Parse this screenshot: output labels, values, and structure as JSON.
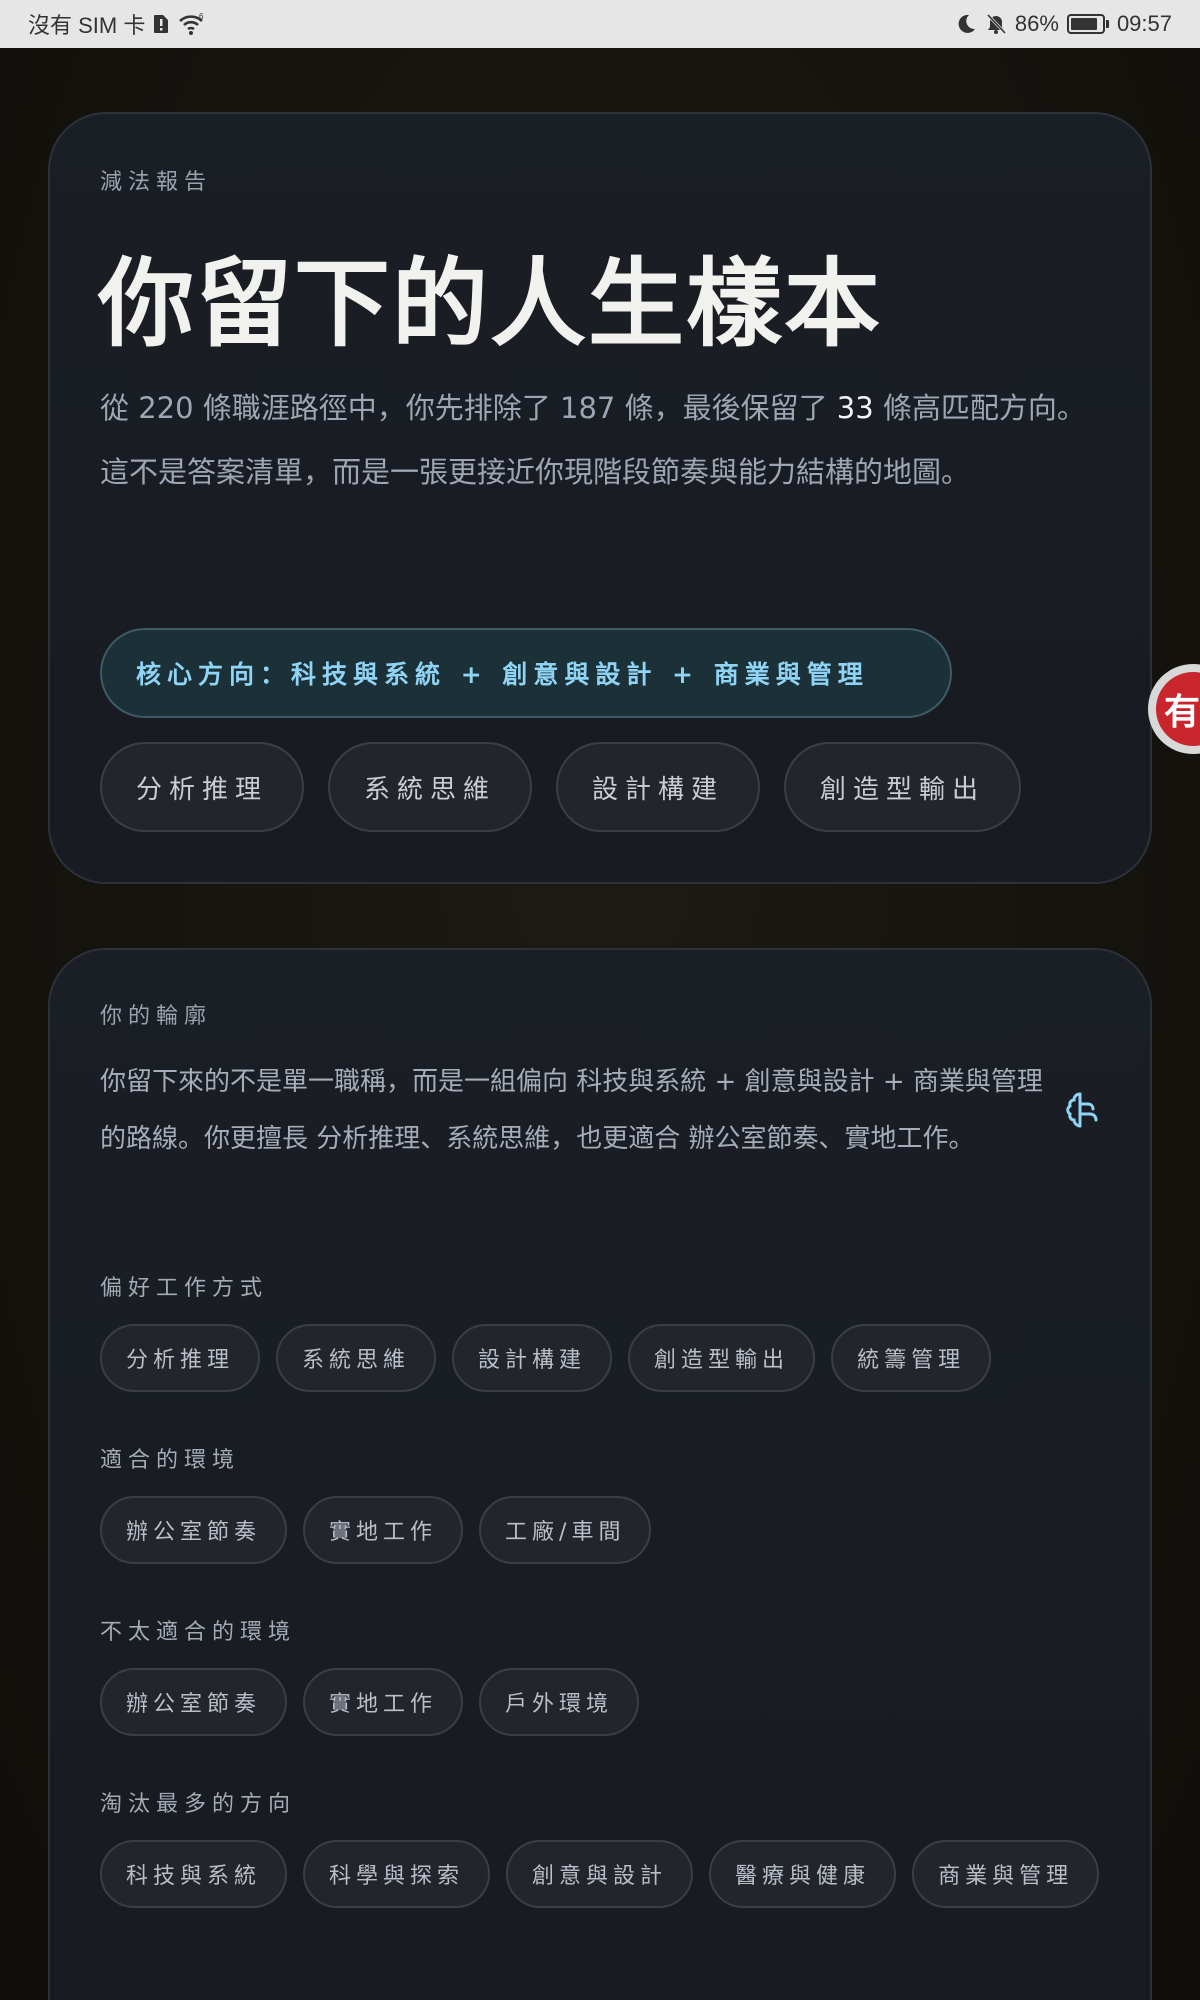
{
  "status_bar": {
    "carrier": "沒有 SIM 卡",
    "battery_percent": "86%",
    "battery_level": 0.86,
    "time": "09:57"
  },
  "report": {
    "eyebrow": "減法報告",
    "title": "你留下的人生樣本",
    "desc_part1": "從 220 條職涯路徑中，你先排除了 187 條，最後保留了 ",
    "desc_highlight": "33",
    "desc_part2": " 條高匹配方向。這不是答案清單，而是一張更接近你現階段節奏與能力結構的地圖。",
    "core_direction": "核心方向：科技與系統 + 創意與設計 + 商業與管理",
    "strengths": [
      "分析推理",
      "系統思維",
      "設計構建",
      "創造型輸出"
    ]
  },
  "profile": {
    "eyebrow": "你的輪廓",
    "text": "你留下來的不是單一職稱，而是一組偏向 科技與系統 + 創意與設計 + 商業與管理 的路線。你更擅長 分析推理、系統思維，也更適合 辦公室節奏、實地工作。",
    "sections": [
      {
        "label": "偏好工作方式",
        "chips": [
          "分析推理",
          "系統思維",
          "設計構建",
          "創造型輸出",
          "統籌管理"
        ]
      },
      {
        "label": "適合的環境",
        "chips": [
          "辦公室節奏",
          "實地工作",
          "工廠/車間"
        ]
      },
      {
        "label": "不太適合的環境",
        "chips": [
          "辦公室節奏",
          "實地工作",
          "戶外環境"
        ]
      },
      {
        "label": "淘汰最多的方向",
        "chips": [
          "科技與系統",
          "科學與探索",
          "創意與設計",
          "醫療與健康",
          "商業與管理"
        ]
      }
    ]
  },
  "side_badge": {
    "glyph": "有"
  },
  "colors": {
    "accent": "#8fd3f5",
    "card_bg": "#1a1e25",
    "page_bg": "#17150f"
  }
}
